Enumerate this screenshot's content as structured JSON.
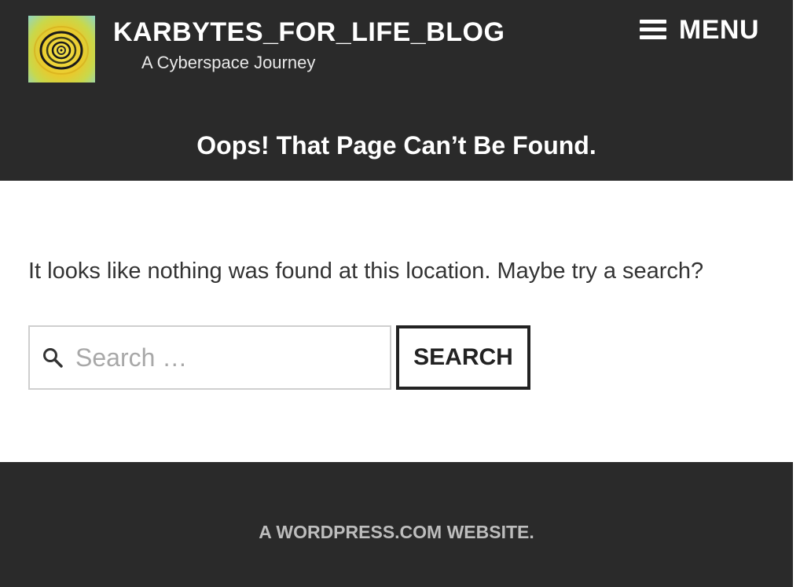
{
  "header": {
    "site_title": "KARBYTES_FOR_LIFE_BLOG",
    "tagline": "A Cyberspace Journey",
    "menu_label": "MENU",
    "page_title": "Oops! That Page Can’t Be Found."
  },
  "main": {
    "message": "It looks like nothing was found at this location. Maybe try a search?",
    "search": {
      "placeholder": "Search …",
      "value": "",
      "button_label": "SEARCH"
    }
  },
  "footer": {
    "credit": "A WORDPRESS.COM WEBSITE."
  },
  "colors": {
    "header_bg": "#2a2a2a",
    "footer_bg": "#2a2a2a",
    "text_light": "#ffffff",
    "footer_text": "#bdbdbd"
  },
  "icons": {
    "menu": "hamburger-menu-icon",
    "search": "search-icon"
  }
}
